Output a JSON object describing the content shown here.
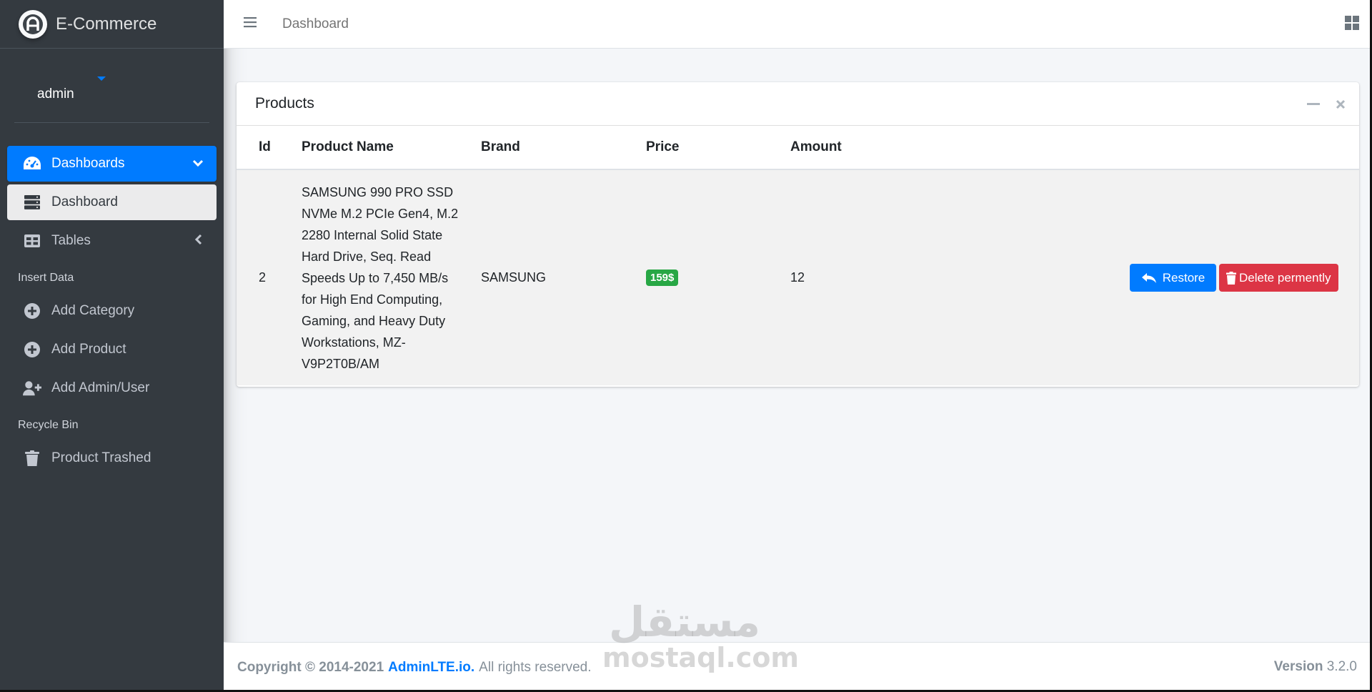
{
  "brand": {
    "name": "E-Commerce",
    "logo_letter": "A"
  },
  "user": {
    "name": "admin"
  },
  "sidebar": {
    "items": [
      {
        "label": "Dashboards",
        "icon": "tachometer-icon",
        "state": "active",
        "right_icon": "chevron-down-icon"
      },
      {
        "label": "Dashboard",
        "icon": "server-icon",
        "state": "sub-active"
      },
      {
        "label": "Tables",
        "icon": "table-icon",
        "state": "normal",
        "right_icon": "chevron-left-icon"
      }
    ],
    "header_insert": "Insert Data",
    "insert_items": [
      {
        "label": "Add Category",
        "icon": "plus-circle-icon"
      },
      {
        "label": "Add Product",
        "icon": "plus-circle-icon"
      },
      {
        "label": "Add Admin/User",
        "icon": "user-plus-icon"
      }
    ],
    "header_recycle": "Recycle Bin",
    "recycle_items": [
      {
        "label": "Product Trashed",
        "icon": "trash-icon"
      }
    ]
  },
  "topbar": {
    "breadcrumb": "Dashboard"
  },
  "card": {
    "title": "Products",
    "columns": [
      "Id",
      "Product Name",
      "Brand",
      "Price",
      "Amount"
    ],
    "rows": [
      {
        "id": "2",
        "name": "SAMSUNG 990 PRO SSD NVMe M.2 PCIe Gen4, M.2 2280 Internal Solid State Hard Drive, Seq. Read Speeds Up to 7,450 MB/s for High End Computing, Gaming, and Heavy Duty Workstations, MZ-V9P2T0B/AM",
        "brand": "SAMSUNG",
        "price": "159$",
        "amount": "12",
        "restore_label": "Restore",
        "delete_label": "Delete permently"
      }
    ]
  },
  "footer": {
    "copyright": "Copyright © 2014-2021",
    "link": "AdminLTE.io.",
    "rights": "All rights reserved.",
    "version_label": "Version",
    "version": "3.2.0"
  },
  "watermark": {
    "arabic": "مستقل",
    "latin": "mostaql.com"
  },
  "colors": {
    "primary": "#007bff",
    "danger": "#dc3545",
    "success": "#28a745",
    "sidebar": "#343a40"
  }
}
